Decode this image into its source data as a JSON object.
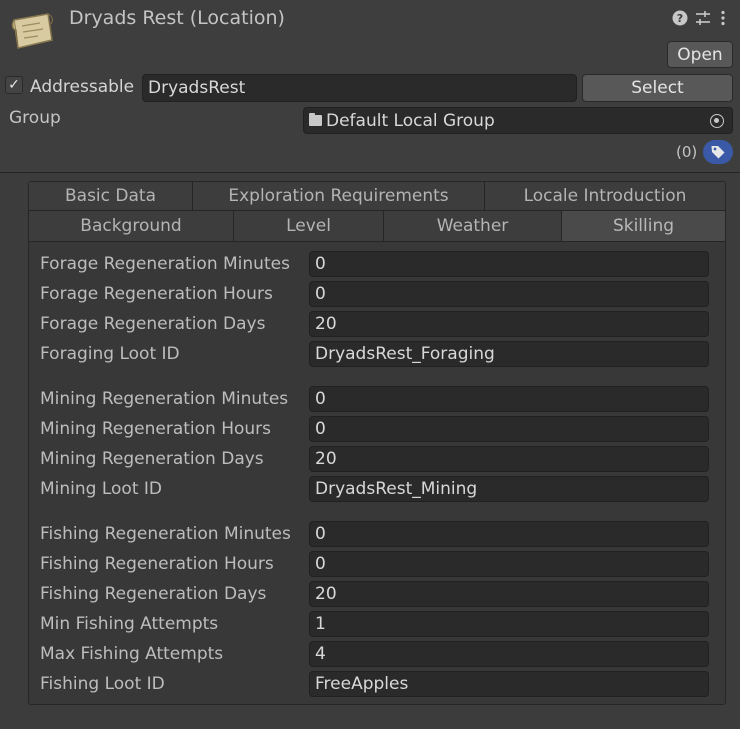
{
  "header": {
    "title": "Dryads Rest (Location)",
    "icons": [
      "help-icon",
      "settings-sliders-icon",
      "more-icon"
    ],
    "open_label": "Open"
  },
  "addressable": {
    "checked": true,
    "label": "Addressable",
    "address": "DryadsRest",
    "select_label": "Select"
  },
  "group": {
    "label": "Group",
    "value": "Default Local Group",
    "labels_count": "(0)"
  },
  "tabs": {
    "row1": [
      "Basic Data",
      "Exploration Requirements",
      "Locale Introduction"
    ],
    "row2": [
      "Background",
      "Level",
      "Weather",
      "Skilling"
    ],
    "active": "Skilling"
  },
  "fields": [
    {
      "label": "Forage Regeneration Minutes",
      "value": "0"
    },
    {
      "label": "Forage Regeneration Hours",
      "value": "0"
    },
    {
      "label": "Forage Regeneration Days",
      "value": "20"
    },
    {
      "label": "Foraging Loot ID",
      "value": "DryadsRest_Foraging"
    },
    {
      "label": "Mining Regeneration Minutes",
      "value": "0"
    },
    {
      "label": "Mining Regeneration Hours",
      "value": "0"
    },
    {
      "label": "Mining Regeneration Days",
      "value": "20"
    },
    {
      "label": "Mining Loot ID",
      "value": "DryadsRest_Mining"
    },
    {
      "label": "Fishing Regeneration Minutes",
      "value": "0"
    },
    {
      "label": "Fishing Regeneration Hours",
      "value": "0"
    },
    {
      "label": "Fishing Regeneration Days",
      "value": "20"
    },
    {
      "label": "Min Fishing Attempts",
      "value": "1"
    },
    {
      "label": "Max Fishing Attempts",
      "value": "4"
    },
    {
      "label": "Fishing Loot ID",
      "value": "FreeApples"
    }
  ]
}
